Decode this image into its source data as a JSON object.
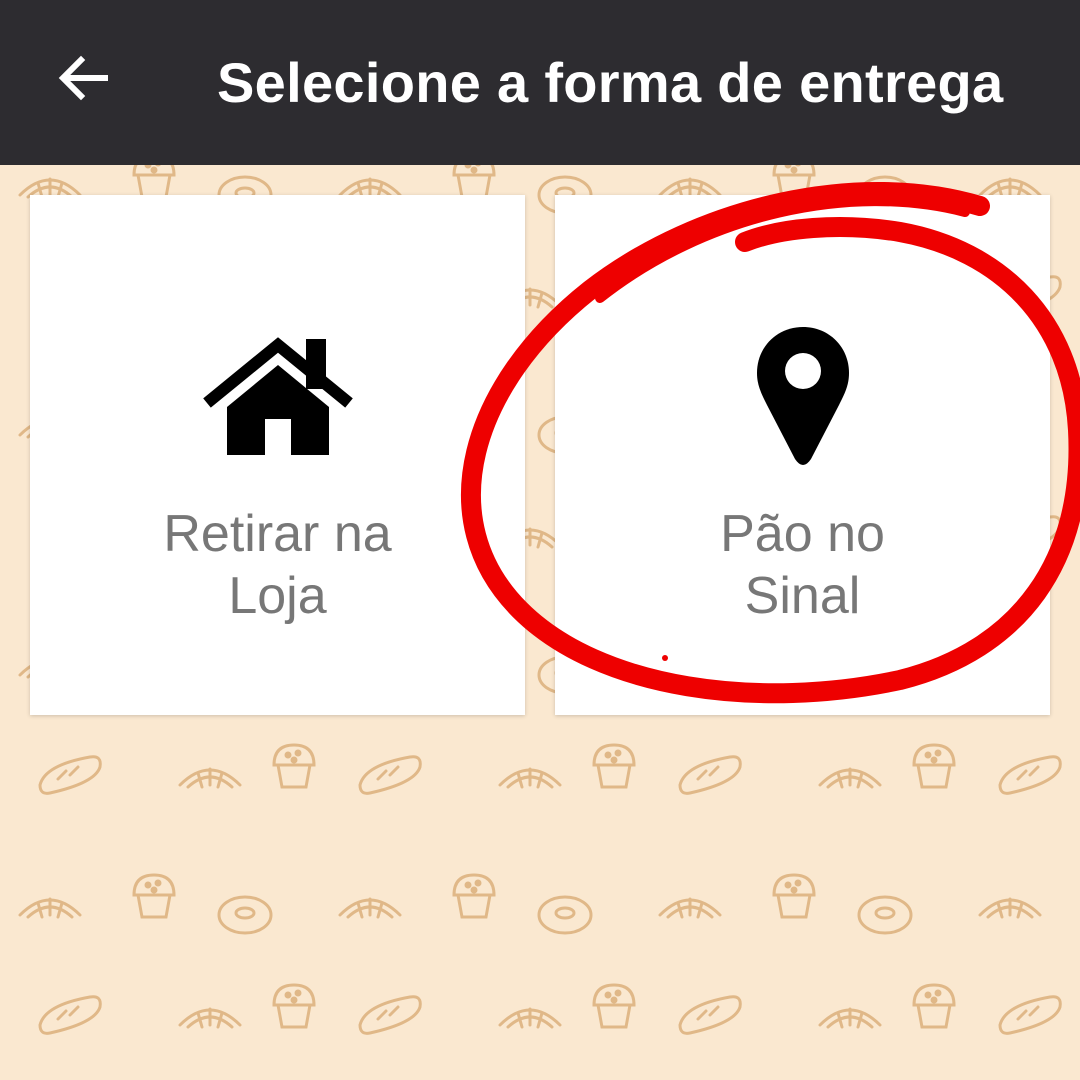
{
  "header": {
    "title": "Selecione a forma de entrega",
    "back_icon": "arrow-left-icon",
    "background": "#2d2c30"
  },
  "options": [
    {
      "icon": "home-icon",
      "label_line1": "Retirar na",
      "label_line2": "Loja"
    },
    {
      "icon": "map-pin-icon",
      "label_line1": "Pão no",
      "label_line2": "Sinal"
    }
  ],
  "annotation": {
    "color": "#ee0000",
    "target": "Pão no Sinal"
  },
  "colors": {
    "background": "#fae8d0",
    "pattern": "#e3bd8e",
    "label": "#777777"
  }
}
